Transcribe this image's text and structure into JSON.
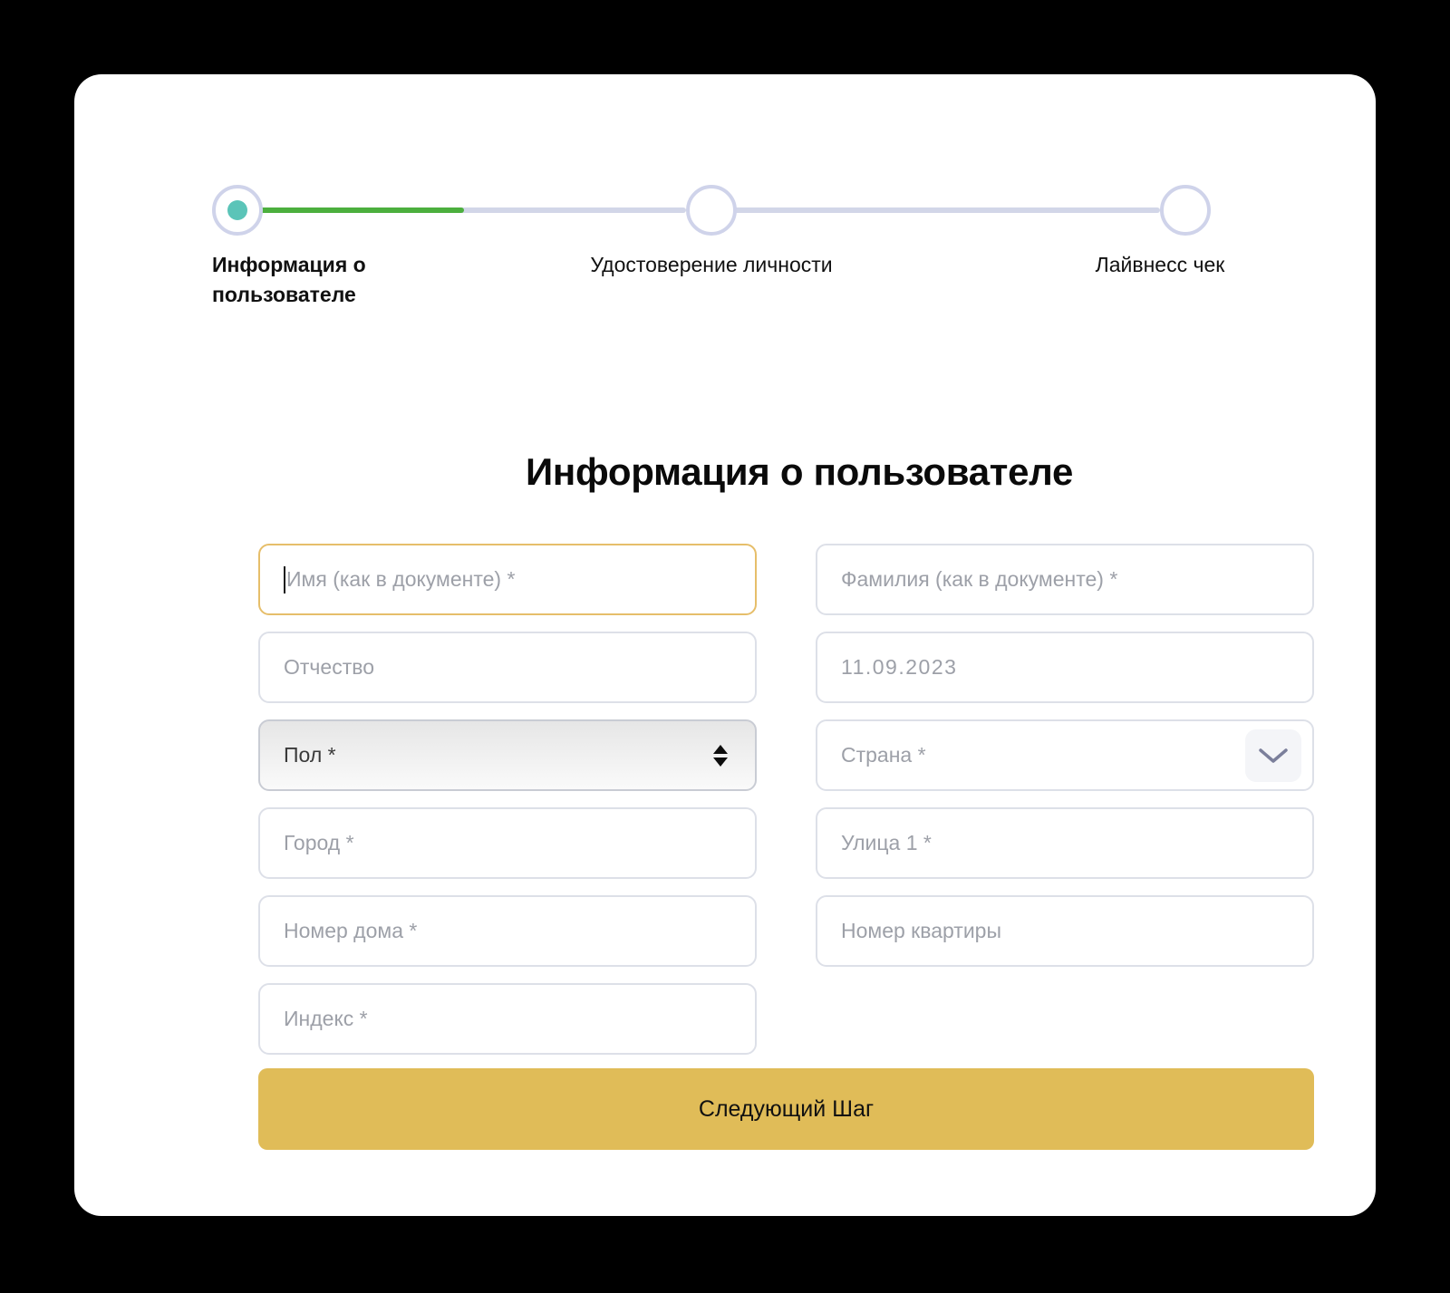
{
  "stepper": {
    "steps": [
      {
        "label": "Информация о\nпользователе",
        "state": "active",
        "icon": "filled-dot-icon"
      },
      {
        "label": "Удостоверение личности",
        "state": "pending",
        "icon": "empty-circle-icon"
      },
      {
        "label": "Лайвнесс чек",
        "state": "pending",
        "icon": "empty-circle-icon"
      }
    ],
    "colors": {
      "active_dot": "#5BC4B8",
      "ring": "#CFD3EA",
      "progress": "#4CAF3E",
      "track": "#D2D6E8"
    }
  },
  "page": {
    "title": "Информация о пользователе"
  },
  "form": {
    "first_name": {
      "placeholder": "Имя (как в документе) *",
      "value": "",
      "focused": true
    },
    "last_name": {
      "placeholder": "Фамилия (как в документе) *",
      "value": ""
    },
    "middle_name": {
      "placeholder": "Отчество",
      "value": ""
    },
    "birth_date": {
      "placeholder": "11.09.2023",
      "value": "11.09.2023"
    },
    "gender": {
      "placeholder": "Пол *",
      "value": "Пол *",
      "control": "select"
    },
    "country": {
      "placeholder": "Страна *",
      "value": "",
      "control": "dropdown",
      "icon": "chevron-down-icon"
    },
    "city": {
      "placeholder": "Город *",
      "value": ""
    },
    "street": {
      "placeholder": "Улица 1 *",
      "value": ""
    },
    "house_number": {
      "placeholder": "Номер дома *",
      "value": ""
    },
    "apartment_number": {
      "placeholder": "Номер квартиры",
      "value": ""
    },
    "postal_code": {
      "placeholder": "Индекс *",
      "value": ""
    }
  },
  "actions": {
    "next_step": "Следующий Шаг"
  },
  "colors": {
    "accent_gold": "#E0BC58",
    "focus_border": "#E6BE6A",
    "field_border": "#DDE0E8",
    "placeholder_text": "#9DA0A8",
    "card_background": "#FFFFFF",
    "page_background": "#000000"
  }
}
